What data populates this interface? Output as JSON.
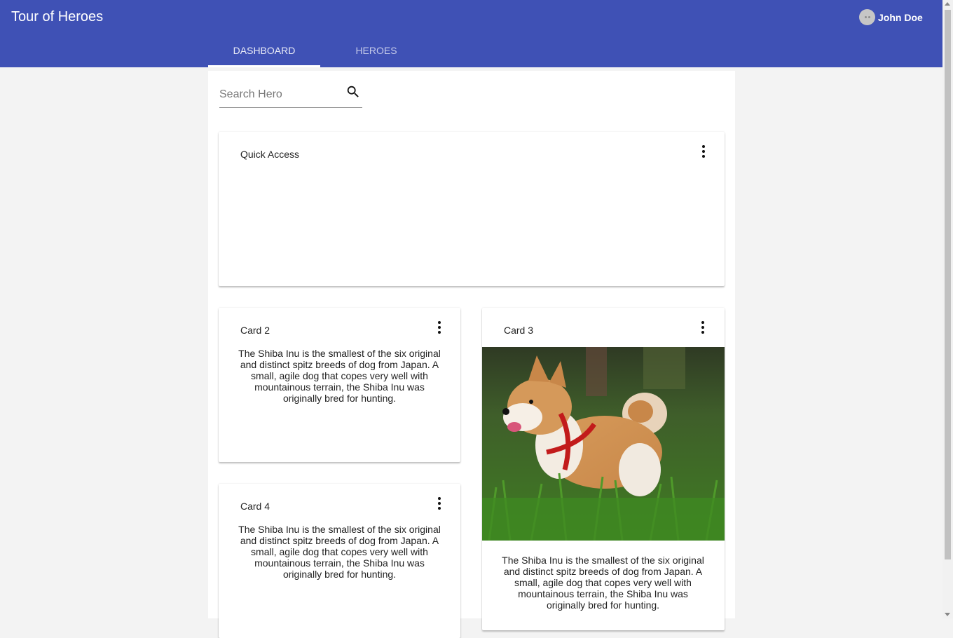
{
  "app": {
    "title": "Tour of Heroes"
  },
  "user": {
    "name": "John Doe",
    "avatar_icon": "avatar-icon"
  },
  "tabs": [
    {
      "label": "DASHBOARD",
      "active": true
    },
    {
      "label": "HEROES",
      "active": false
    }
  ],
  "search": {
    "placeholder": "Search Hero",
    "value": "",
    "icon": "search-icon"
  },
  "cards": [
    {
      "title": "Quick Access",
      "text": ""
    },
    {
      "title": "Card 2",
      "text": "The Shiba Inu is the smallest of the six original and distinct spitz breeds of dog from Japan. A small, agile dog that copes very well with mountainous terrain, the Shiba Inu was originally bred for hunting."
    },
    {
      "title": "Card 3",
      "text": "The Shiba Inu is the smallest of the six original and distinct spitz breeds of dog from Japan. A small, agile dog that copes very well with mountainous terrain, the Shiba Inu was originally bred for hunting.",
      "image": "shiba-inu-photo"
    },
    {
      "title": "Card 4",
      "text": "The Shiba Inu is the smallest of the six original and distinct spitz breeds of dog from Japan. A small, agile dog that copes very well with mountainous terrain, the Shiba Inu was originally bred for hunting."
    }
  ],
  "colors": {
    "primary": "#3f51b5",
    "background": "#f3f3f3",
    "accent_indicator": "#ffffff"
  },
  "icons": {
    "card_menu": "more-vert-icon"
  }
}
